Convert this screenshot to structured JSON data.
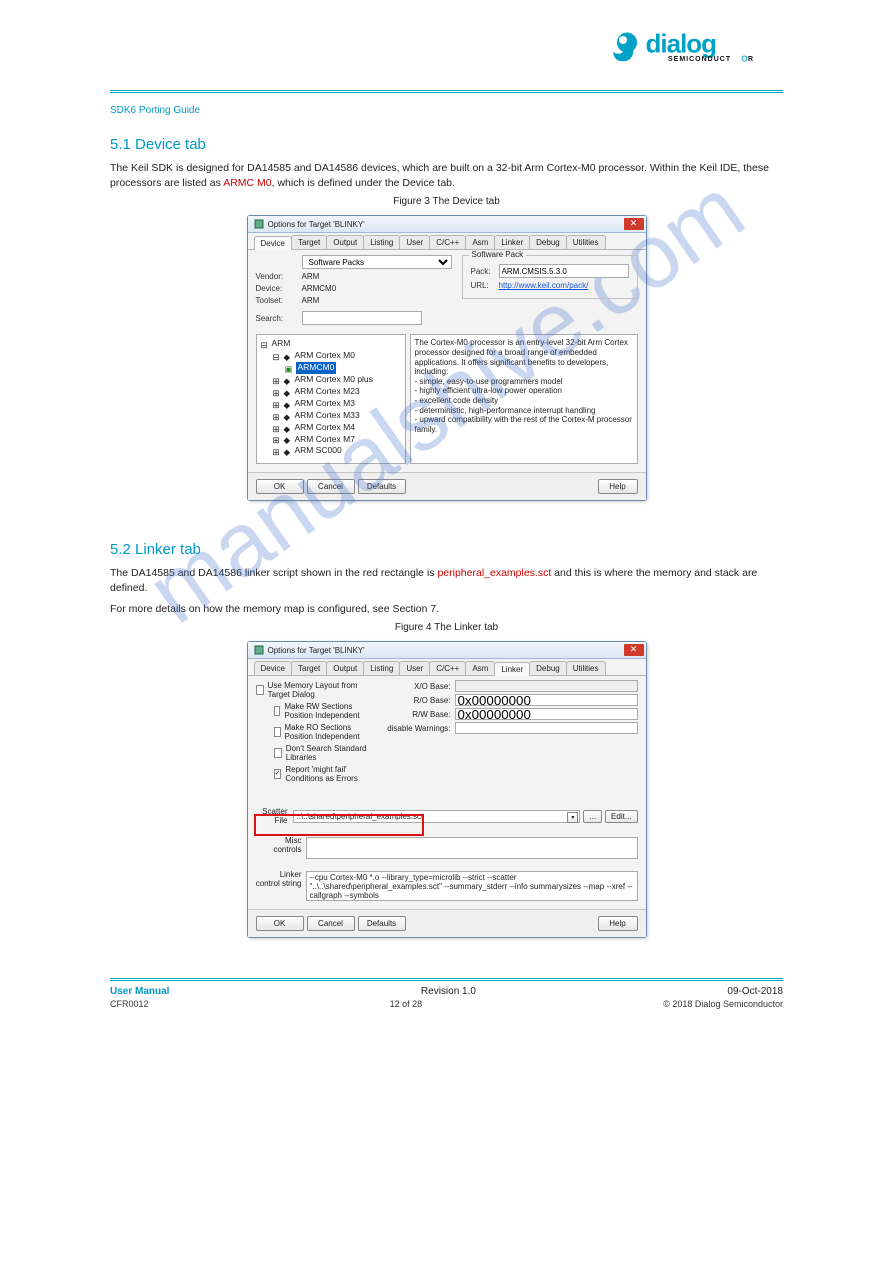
{
  "page": {
    "chapter_head": "SDK6 Porting Guide",
    "watermark": "manualshive.com"
  },
  "brand": {
    "name": "dialog",
    "sub": "SEMICONDUCTOR"
  },
  "sec1": {
    "title": "5.1 Device tab",
    "p1": "The Keil SDK is designed for DA14585 and DA14586 devices, which are built on a 32-bit Arm Cortex-M0 processor. Within the Keil IDE, these processors are listed as ",
    "p1_code": "ARMC M0",
    "p1_tail": ", which is defined under the Device tab."
  },
  "fig1": {
    "caption": "Figure 3 The Device tab"
  },
  "dlg1": {
    "title": "Options for Target 'BLINKY'",
    "tabs": [
      "Device",
      "Target",
      "Output",
      "Listing",
      "User",
      "C/C++",
      "Asm",
      "Linker",
      "Debug",
      "Utilities"
    ],
    "active_tab_index": 0,
    "packs_sel": "Software Packs",
    "vendor_lbl": "Vendor:",
    "vendor_val": "ARM",
    "device_lbl": "Device:",
    "device_val": "ARMCM0",
    "toolset_lbl": "Toolset:",
    "toolset_val": "ARM",
    "search_lbl": "Search:",
    "packgroup": "Software Pack",
    "pack_lbl": "Pack:",
    "pack_val": "ARM.CMSIS.5.3.0",
    "url_lbl": "URL:",
    "url_val": "http://www.keil.com/pack/",
    "tree": {
      "root": "ARM",
      "items": [
        "ARM Cortex M0",
        "ARMCM0",
        "ARM Cortex M0 plus",
        "ARM Cortex M23",
        "ARM Cortex M3",
        "ARM Cortex M33",
        "ARM Cortex M4",
        "ARM Cortex M7",
        "ARM SC000"
      ],
      "selected": "ARMCM0"
    },
    "desc": "The Cortex-M0 processor is an entry-level 32-bit Arm Cortex processor designed for a broad range of embedded applications. It offers significant benefits to developers, including:\n- simple, easy-to-use programmers model\n- highly efficient ultra-low power operation\n- excellent code density\n- deterministic, high-performance interrupt handling\n- upward compatibility with the rest of the Cortex-M processor family.",
    "buttons": {
      "ok": "OK",
      "cancel": "Cancel",
      "defaults": "Defaults",
      "help": "Help"
    }
  },
  "sec2": {
    "title": "5.2 Linker tab",
    "p1": "The DA14585 and DA14586 linker script shown in the red rectangle is ",
    "p1_code": "peripheral_examples.sct",
    "p1_tail": " and this is where the memory and stack are defined.",
    "p2a": "For more details on how the memory map is configured, see ",
    "p2_code": "Section 7",
    "p2b": "."
  },
  "fig2": {
    "caption": "Figure 4 The Linker tab"
  },
  "dlg2": {
    "title": "Options for Target 'BLINKY'",
    "tabs": [
      "Device",
      "Target",
      "Output",
      "Listing",
      "User",
      "C/C++",
      "Asm",
      "Linker",
      "Debug",
      "Utilities"
    ],
    "active_tab_index": 7,
    "memlayout": "Use Memory Layout from Target Dialog",
    "rw_pi": "Make RW Sections Position Independent",
    "ro_pi": "Make RO Sections Position Independent",
    "nosearch": "Don't Search Standard Libraries",
    "reporterr": "Report 'might fail' Conditions as Errors",
    "xobase_lbl": "X/O Base:",
    "robase_lbl": "R/O Base:",
    "robase_val": "0x00000000",
    "rwbase_lbl": "R/W Base:",
    "rwbase_val": "0x00000000",
    "diswarn_lbl": "disable Warnings:",
    "scatter_lbl": "Scatter\nFile",
    "scatter_val": "..\\..\\shared\\peripheral_examples.sct",
    "browse": "...",
    "edit": "Edit...",
    "misc_lbl": "Misc\ncontrols",
    "linker_lbl": "Linker\ncontrol\nstring",
    "linker_val": "--cpu Cortex-M0 *.o\n--library_type=microlib --strict --scatter \"..\\..\\shared\\peripheral_examples.sct\"\n--summary_stderr --info summarysizes --map --xref --callgraph --symbols",
    "buttons": {
      "ok": "OK",
      "cancel": "Cancel",
      "defaults": "Defaults",
      "help": "Help"
    }
  },
  "footer": {
    "left": "User Manual",
    "center": "Revision 1.0",
    "right": "09-Oct-2018",
    "l2_left": "CFR0012",
    "l2_center": "12 of 28",
    "l2_right": "© 2018 Dialog Semiconductor"
  }
}
